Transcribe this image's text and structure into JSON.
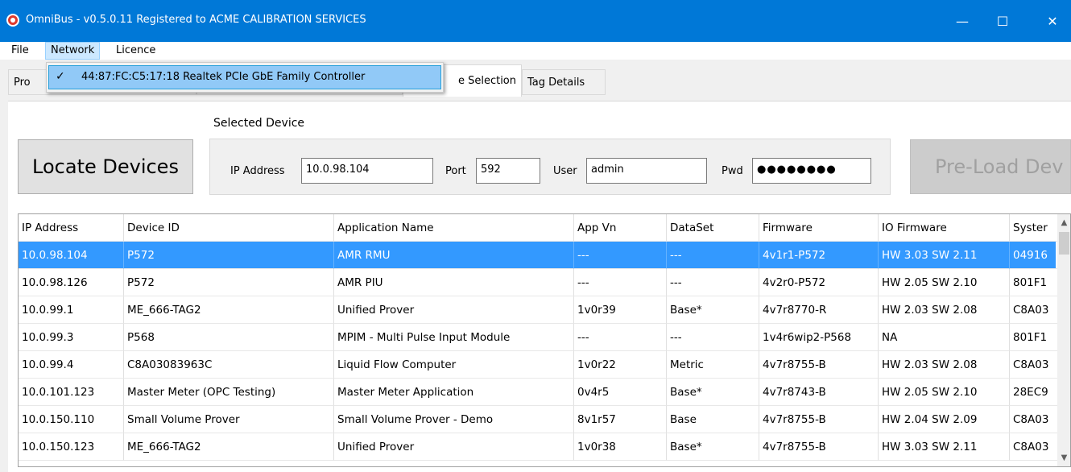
{
  "window": {
    "title": "OmniBus - v0.5.0.11  Registered to ACME CALIBRATION SERVICES",
    "minimize": "—",
    "maximize": "☐",
    "close": "✕"
  },
  "menu": {
    "file": "File",
    "network": "Network",
    "licence": "Licence"
  },
  "network_dropdown": {
    "items": [
      {
        "checked": true,
        "check": "✓",
        "label": "44:87:FC:C5:17:18 Realtek PCIe GbE Family Controller"
      }
    ]
  },
  "tabs": [
    {
      "label": "Program Configuration",
      "visible_fragment": "Pro"
    },
    {
      "label": ""
    },
    {
      "label": "Device Selection",
      "visible_fragment": "e Selection",
      "active": true
    },
    {
      "label": "Tag Details"
    }
  ],
  "locate_button": "Locate Devices",
  "selected_device": {
    "group_label": "Selected Device",
    "ip_label": "IP Address",
    "ip_value": "10.0.98.104",
    "port_label": "Port",
    "port_value": "592",
    "user_label": "User",
    "user_value": "admin",
    "pwd_label": "Pwd",
    "pwd_value": "●●●●●●●●"
  },
  "preload_button": "Pre-Load Dev",
  "grid": {
    "columns": [
      "IP Address",
      "Device ID",
      "Application Name",
      "App Vn",
      "DataSet",
      "Firmware",
      "IO Firmware",
      "Syster"
    ],
    "selected_row": 0,
    "rows": [
      [
        "10.0.98.104",
        "P572",
        "AMR RMU",
        "---",
        "---",
        "4v1r1-P572",
        "HW 3.03 SW 2.11",
        "04916"
      ],
      [
        "10.0.98.126",
        "P572",
        "AMR PIU",
        "---",
        "---",
        "4v2r0-P572",
        "HW 2.05 SW 2.10",
        "801F1"
      ],
      [
        "10.0.99.1",
        "ME_666-TAG2",
        "Unified Prover",
        "1v0r39",
        "Base*",
        "4v7r8770-R",
        "HW 2.03 SW 2.08",
        "C8A03"
      ],
      [
        "10.0.99.3",
        "P568",
        "MPIM - Multi Pulse Input Module",
        "---",
        "---",
        "1v4r6wip2-P568",
        "NA",
        "801F1"
      ],
      [
        "10.0.99.4",
        "C8A03083963C",
        "Liquid Flow Computer",
        "1v0r22",
        "Metric",
        "4v7r8755-B",
        "HW 2.03 SW 2.08",
        "C8A03"
      ],
      [
        "10.0.101.123",
        "Master Meter (OPC Testing)",
        "Master Meter Application",
        "0v4r5",
        "Base*",
        "4v7r8743-B",
        "HW 2.05 SW 2.10",
        "28EC9"
      ],
      [
        "10.0.150.110",
        "Small Volume Prover",
        "Small Volume Prover - Demo",
        "8v1r57",
        "Base",
        "4v7r8755-B",
        "HW 2.04 SW 2.09",
        "C8A03"
      ],
      [
        "10.0.150.123",
        "ME_666-TAG2",
        "Unified Prover",
        "1v0r38",
        "Base*",
        "4v7r8755-B",
        "HW 3.03 SW 2.11",
        "C8A03"
      ]
    ]
  },
  "scrollbar": {
    "up": "▲",
    "down": "▼"
  },
  "colors": {
    "titlebar": "#0078d7",
    "selection": "#3399ff",
    "menu_highlight": "#cce8ff",
    "dropdown_highlight": "#91c9f7"
  }
}
